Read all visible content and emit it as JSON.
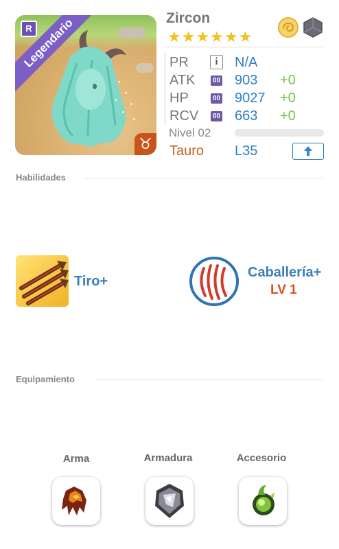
{
  "hero": {
    "name": "Zircon",
    "rarity": "Legendario",
    "rarity_badge": "R",
    "stars": "★★★★★★",
    "star_count": 6,
    "zodiac_symbol": "♉",
    "element_icons": [
      "light-orb-icon",
      "rock-icon"
    ]
  },
  "stats": [
    {
      "label": "PR",
      "badge": "i",
      "value": "N/A",
      "bonus": ""
    },
    {
      "label": "ATK",
      "badge": "00",
      "value": "903",
      "bonus": "+0"
    },
    {
      "label": "HP",
      "badge": "00",
      "value": "9027",
      "bonus": "+0"
    },
    {
      "label": "RCV",
      "badge": "00",
      "value": "663",
      "bonus": "+0"
    }
  ],
  "level": {
    "label": "Nivel 02",
    "progress": 0,
    "sign": "Tauro",
    "cap": "L35"
  },
  "skills_section": {
    "title": "Habilidades",
    "skills": [
      {
        "name": "Tiro+",
        "level": ""
      },
      {
        "name": "Caballería+",
        "level": "LV 1"
      }
    ]
  },
  "equipment_section": {
    "title": "Equipamiento",
    "slots": [
      {
        "label": "Arma",
        "icon": "claw-gauntlet-icon"
      },
      {
        "label": "Armadura",
        "icon": "armor-plate-icon"
      },
      {
        "label": "Accesorio",
        "icon": "green-orb-icon"
      }
    ]
  },
  "colors": {
    "accent": "#2f7fc1",
    "bonus": "#72c442",
    "rarity": "#7b5fc6",
    "sign": "#c0621b",
    "skill_level": "#d2541c",
    "stars": "#f2c21e"
  }
}
